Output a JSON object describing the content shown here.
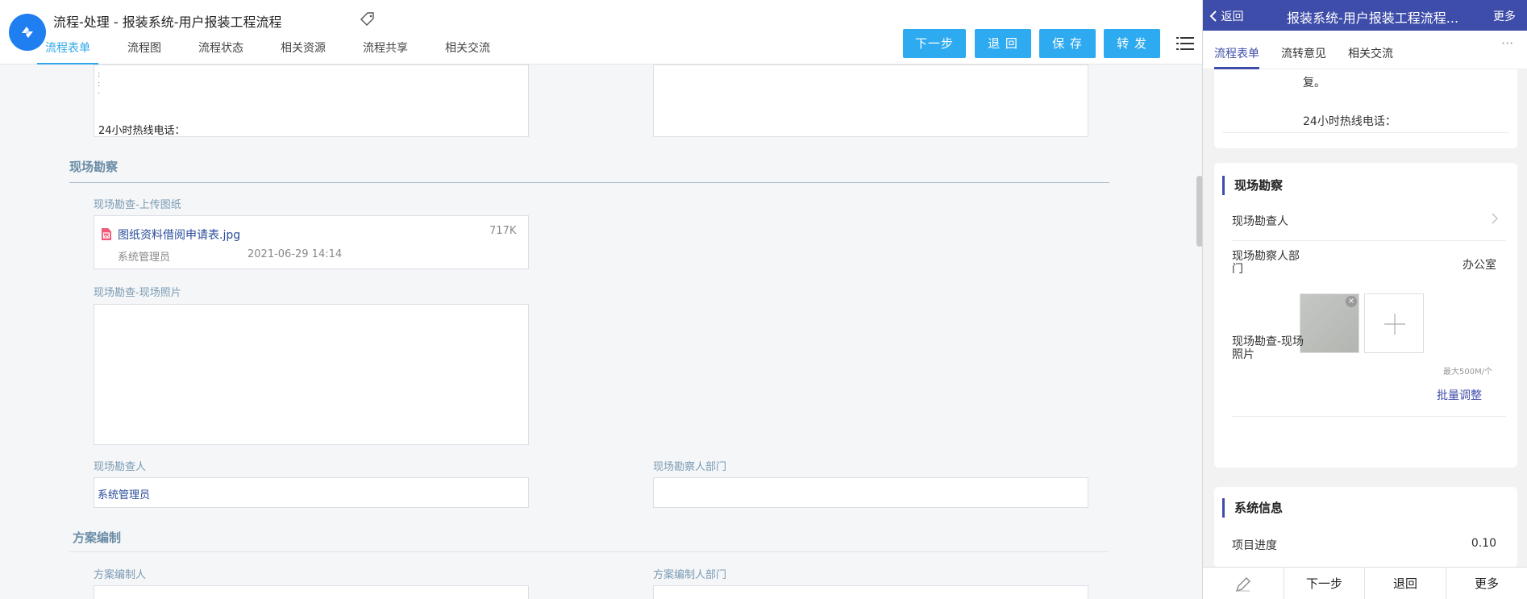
{
  "window": {
    "title": "流程-处理 - 报装系统-用户报装工程流程"
  },
  "tabs": [
    {
      "label": "流程表单",
      "active": true
    },
    {
      "label": "流程图",
      "active": false
    },
    {
      "label": "流程状态",
      "active": false
    },
    {
      "label": "相关资源",
      "active": false
    },
    {
      "label": "流程共享",
      "active": false
    },
    {
      "label": "相关交流",
      "active": false
    }
  ],
  "toolbar": {
    "next_label": "下一步",
    "return_label": "退 回",
    "save_label": "保 存",
    "forward_label": "转 发",
    "button_color": "#2eaaf0"
  },
  "form": {
    "top_box_text": "24小时热线电话：",
    "site_survey": {
      "title": "现场勘察",
      "drawing_label": "现场勘查-上传图纸",
      "attachment": {
        "file_name": "图纸资料借阅申请表.jpg",
        "size": "717K",
        "uploader": "系统管理员",
        "time": "2021-06-29 14:14"
      },
      "photo_label": "现场勘查-现场照片",
      "surveyor_label": "现场勘查人",
      "surveyor_value": "系统管理员",
      "surveyor_dept_label": "现场勘察人部门",
      "surveyor_dept_value": ""
    },
    "plan": {
      "title": "方案编制",
      "author_label": "方案编制人",
      "author_dept_label": "方案编制人部门"
    }
  },
  "mobile": {
    "back_label": "返回",
    "title": "报装系统-用户报装工程流程...",
    "more_label": "更多",
    "header_color": "#3e4caa",
    "tabs": [
      {
        "label": "流程表单",
        "active": true
      },
      {
        "label": "流转意见",
        "active": false
      },
      {
        "label": "相关交流",
        "active": false
      }
    ],
    "top_card": {
      "line1": "复。",
      "line2": "24小时热线电话："
    },
    "site_survey": {
      "title": "现场勘察",
      "surveyor_label": "现场勘查人",
      "surveyor_dept_label_line1": "现场勘察人部",
      "surveyor_dept_label_line2": "门",
      "surveyor_dept_value": "办公室",
      "photo_label_line1": "现场勘查-现场",
      "photo_label_line2": "照片",
      "max_size_hint": "最大500M/个",
      "batch_adjust_label": "批量调整"
    },
    "system_info": {
      "title": "系统信息",
      "progress_label": "项目进度",
      "progress_value": "0.10"
    },
    "footer": {
      "next_label": "下一步",
      "return_label": "退回",
      "more_label": "更多"
    }
  }
}
